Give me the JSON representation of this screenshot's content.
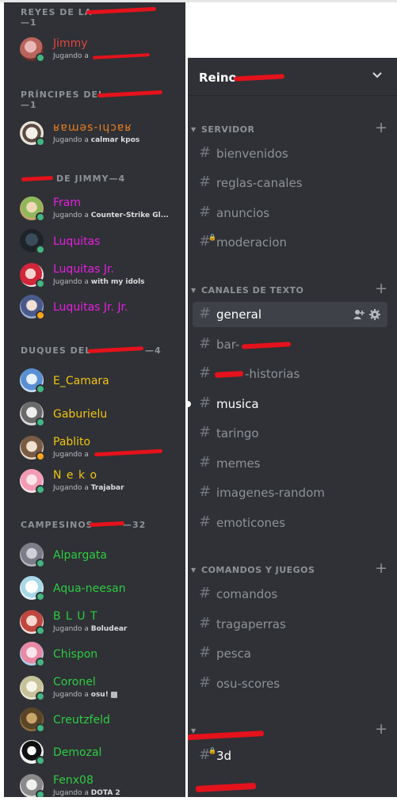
{
  "member_groups": [
    {
      "header": "REYES DE LA",
      "count_line": "—1",
      "members": [
        {
          "name": "Jimmy",
          "activity_prefix": "Jugando a",
          "activity": "",
          "name_color": "#e0443e",
          "status": "online"
        }
      ]
    },
    {
      "header": "PRÍNCIPES DEL",
      "count_line": "—1",
      "members": [
        {
          "name": "ʁɐɯǝs-ıɥɔɐʁ",
          "activity_prefix": "Jugando a",
          "activity": "calmar kpos",
          "name_color": "#e67e22",
          "status": "online"
        }
      ]
    },
    {
      "header": "DE JIMMY—4",
      "members": [
        {
          "name": "Fram",
          "activity_prefix": "Jugando a",
          "activity": "Counter-Strike Gl...",
          "name_color": "#e91ee3",
          "status": "online"
        },
        {
          "name": "Luquitas",
          "activity_prefix": "",
          "activity": "",
          "name_color": "#e91ee3",
          "status": "online"
        },
        {
          "name": "Luquitas Jr.",
          "activity_prefix": "Jugando a",
          "activity": "with my idols",
          "name_color": "#e91ee3",
          "status": "online"
        },
        {
          "name": "Luquitas Jr. Jr.",
          "activity_prefix": "",
          "activity": "",
          "name_color": "#e91ee3",
          "status": "idle"
        }
      ]
    },
    {
      "header": "DUQUES DEL",
      "count_line": "—4",
      "members": [
        {
          "name": "E_Camara",
          "activity_prefix": "",
          "activity": "",
          "name_color": "#f1c40f",
          "status": "online"
        },
        {
          "name": "Gaburielu",
          "activity_prefix": "",
          "activity": "",
          "name_color": "#f1c40f",
          "status": "online"
        },
        {
          "name": "Pablito",
          "activity_prefix": "Jugando a",
          "activity": "",
          "name_color": "#f1c40f",
          "status": "idle"
        },
        {
          "name": "N e k o",
          "activity_prefix": "Jugando a",
          "activity": "Trajabar",
          "name_color": "#f1c40f",
          "status": "online"
        }
      ]
    },
    {
      "header": "CAMPESINOS",
      "count_line": "—32",
      "members": [
        {
          "name": "Alpargata",
          "activity_prefix": "",
          "activity": "",
          "name_color": "#2ecc40",
          "status": "online"
        },
        {
          "name": "Aqua-neesan",
          "activity_prefix": "",
          "activity": "",
          "name_color": "#2ecc40",
          "status": "online"
        },
        {
          "name": "B L U T",
          "activity_prefix": "Jugando a",
          "activity": "Boludear",
          "name_color": "#2ecc40",
          "status": "online"
        },
        {
          "name": "Chispon",
          "activity_prefix": "",
          "activity": "",
          "name_color": "#2ecc40",
          "status": "online"
        },
        {
          "name": "Coronel",
          "activity_prefix": "Jugando a",
          "activity": "osu!",
          "name_color": "#2ecc40",
          "status": "online"
        },
        {
          "name": "Creutzfeld",
          "activity_prefix": "",
          "activity": "",
          "name_color": "#2ecc40",
          "status": "online"
        },
        {
          "name": "Demozal",
          "activity_prefix": "",
          "activity": "",
          "name_color": "#2ecc40",
          "status": "online"
        },
        {
          "name": "Fenx08",
          "activity_prefix": "Jugando a",
          "activity": "DOTA 2",
          "name_color": "#2ecc40",
          "status": "online"
        }
      ]
    }
  ],
  "server": {
    "name": "Reino"
  },
  "categories": [
    {
      "label": "SERVIDOR",
      "channels": [
        {
          "name": "bienvenidos",
          "locked": false
        },
        {
          "name": "reglas-canales",
          "locked": false
        },
        {
          "name": "anuncios",
          "locked": false
        },
        {
          "name": "moderacion",
          "locked": true
        }
      ]
    },
    {
      "label": "CANALES DE TEXTO",
      "channels": [
        {
          "name": "general",
          "active": true
        },
        {
          "name": "bar-"
        },
        {
          "name": "-historias"
        },
        {
          "name": "musica",
          "unread": true
        },
        {
          "name": "taringo"
        },
        {
          "name": "memes"
        },
        {
          "name": "imagenes-random"
        },
        {
          "name": "emoticones"
        }
      ]
    },
    {
      "label": "COMANDOS Y JUEGOS",
      "channels": [
        {
          "name": "comandos"
        },
        {
          "name": "tragaperras"
        },
        {
          "name": "pesca"
        },
        {
          "name": "osu-scores"
        }
      ]
    },
    {
      "label": "",
      "channels": [
        {
          "name": "3d",
          "unread": true,
          "locked": true
        }
      ]
    }
  ],
  "colors": {
    "status_online": "#43b581",
    "status_idle": "#faa61a",
    "redaction": "#e4121c"
  }
}
